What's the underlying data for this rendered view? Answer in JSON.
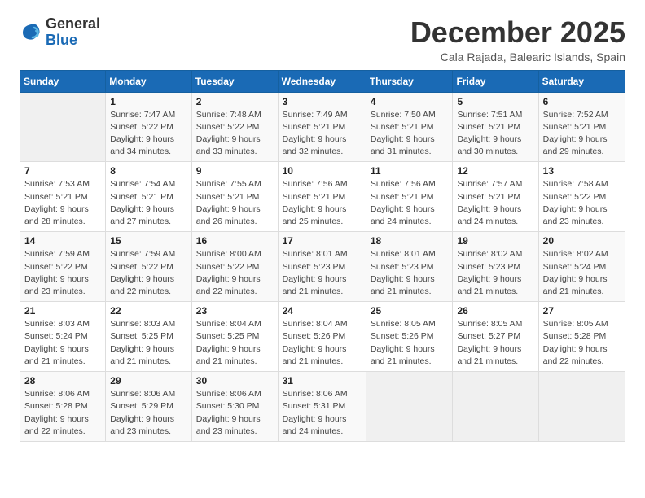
{
  "logo": {
    "general": "General",
    "blue": "Blue"
  },
  "title": "December 2025",
  "location": "Cala Rajada, Balearic Islands, Spain",
  "headers": [
    "Sunday",
    "Monday",
    "Tuesday",
    "Wednesday",
    "Thursday",
    "Friday",
    "Saturday"
  ],
  "weeks": [
    [
      null,
      {
        "day": "1",
        "sunrise": "7:47 AM",
        "sunset": "5:22 PM",
        "daylight": "9 hours and 34 minutes."
      },
      {
        "day": "2",
        "sunrise": "7:48 AM",
        "sunset": "5:22 PM",
        "daylight": "9 hours and 33 minutes."
      },
      {
        "day": "3",
        "sunrise": "7:49 AM",
        "sunset": "5:21 PM",
        "daylight": "9 hours and 32 minutes."
      },
      {
        "day": "4",
        "sunrise": "7:50 AM",
        "sunset": "5:21 PM",
        "daylight": "9 hours and 31 minutes."
      },
      {
        "day": "5",
        "sunrise": "7:51 AM",
        "sunset": "5:21 PM",
        "daylight": "9 hours and 30 minutes."
      },
      {
        "day": "6",
        "sunrise": "7:52 AM",
        "sunset": "5:21 PM",
        "daylight": "9 hours and 29 minutes."
      }
    ],
    [
      {
        "day": "7",
        "sunrise": "7:53 AM",
        "sunset": "5:21 PM",
        "daylight": "9 hours and 28 minutes."
      },
      {
        "day": "8",
        "sunrise": "7:54 AM",
        "sunset": "5:21 PM",
        "daylight": "9 hours and 27 minutes."
      },
      {
        "day": "9",
        "sunrise": "7:55 AM",
        "sunset": "5:21 PM",
        "daylight": "9 hours and 26 minutes."
      },
      {
        "day": "10",
        "sunrise": "7:56 AM",
        "sunset": "5:21 PM",
        "daylight": "9 hours and 25 minutes."
      },
      {
        "day": "11",
        "sunrise": "7:56 AM",
        "sunset": "5:21 PM",
        "daylight": "9 hours and 24 minutes."
      },
      {
        "day": "12",
        "sunrise": "7:57 AM",
        "sunset": "5:21 PM",
        "daylight": "9 hours and 24 minutes."
      },
      {
        "day": "13",
        "sunrise": "7:58 AM",
        "sunset": "5:22 PM",
        "daylight": "9 hours and 23 minutes."
      }
    ],
    [
      {
        "day": "14",
        "sunrise": "7:59 AM",
        "sunset": "5:22 PM",
        "daylight": "9 hours and 23 minutes."
      },
      {
        "day": "15",
        "sunrise": "7:59 AM",
        "sunset": "5:22 PM",
        "daylight": "9 hours and 22 minutes."
      },
      {
        "day": "16",
        "sunrise": "8:00 AM",
        "sunset": "5:22 PM",
        "daylight": "9 hours and 22 minutes."
      },
      {
        "day": "17",
        "sunrise": "8:01 AM",
        "sunset": "5:23 PM",
        "daylight": "9 hours and 21 minutes."
      },
      {
        "day": "18",
        "sunrise": "8:01 AM",
        "sunset": "5:23 PM",
        "daylight": "9 hours and 21 minutes."
      },
      {
        "day": "19",
        "sunrise": "8:02 AM",
        "sunset": "5:23 PM",
        "daylight": "9 hours and 21 minutes."
      },
      {
        "day": "20",
        "sunrise": "8:02 AM",
        "sunset": "5:24 PM",
        "daylight": "9 hours and 21 minutes."
      }
    ],
    [
      {
        "day": "21",
        "sunrise": "8:03 AM",
        "sunset": "5:24 PM",
        "daylight": "9 hours and 21 minutes."
      },
      {
        "day": "22",
        "sunrise": "8:03 AM",
        "sunset": "5:25 PM",
        "daylight": "9 hours and 21 minutes."
      },
      {
        "day": "23",
        "sunrise": "8:04 AM",
        "sunset": "5:25 PM",
        "daylight": "9 hours and 21 minutes."
      },
      {
        "day": "24",
        "sunrise": "8:04 AM",
        "sunset": "5:26 PM",
        "daylight": "9 hours and 21 minutes."
      },
      {
        "day": "25",
        "sunrise": "8:05 AM",
        "sunset": "5:26 PM",
        "daylight": "9 hours and 21 minutes."
      },
      {
        "day": "26",
        "sunrise": "8:05 AM",
        "sunset": "5:27 PM",
        "daylight": "9 hours and 21 minutes."
      },
      {
        "day": "27",
        "sunrise": "8:05 AM",
        "sunset": "5:28 PM",
        "daylight": "9 hours and 22 minutes."
      }
    ],
    [
      {
        "day": "28",
        "sunrise": "8:06 AM",
        "sunset": "5:28 PM",
        "daylight": "9 hours and 22 minutes."
      },
      {
        "day": "29",
        "sunrise": "8:06 AM",
        "sunset": "5:29 PM",
        "daylight": "9 hours and 23 minutes."
      },
      {
        "day": "30",
        "sunrise": "8:06 AM",
        "sunset": "5:30 PM",
        "daylight": "9 hours and 23 minutes."
      },
      {
        "day": "31",
        "sunrise": "8:06 AM",
        "sunset": "5:31 PM",
        "daylight": "9 hours and 24 minutes."
      },
      null,
      null,
      null
    ]
  ]
}
